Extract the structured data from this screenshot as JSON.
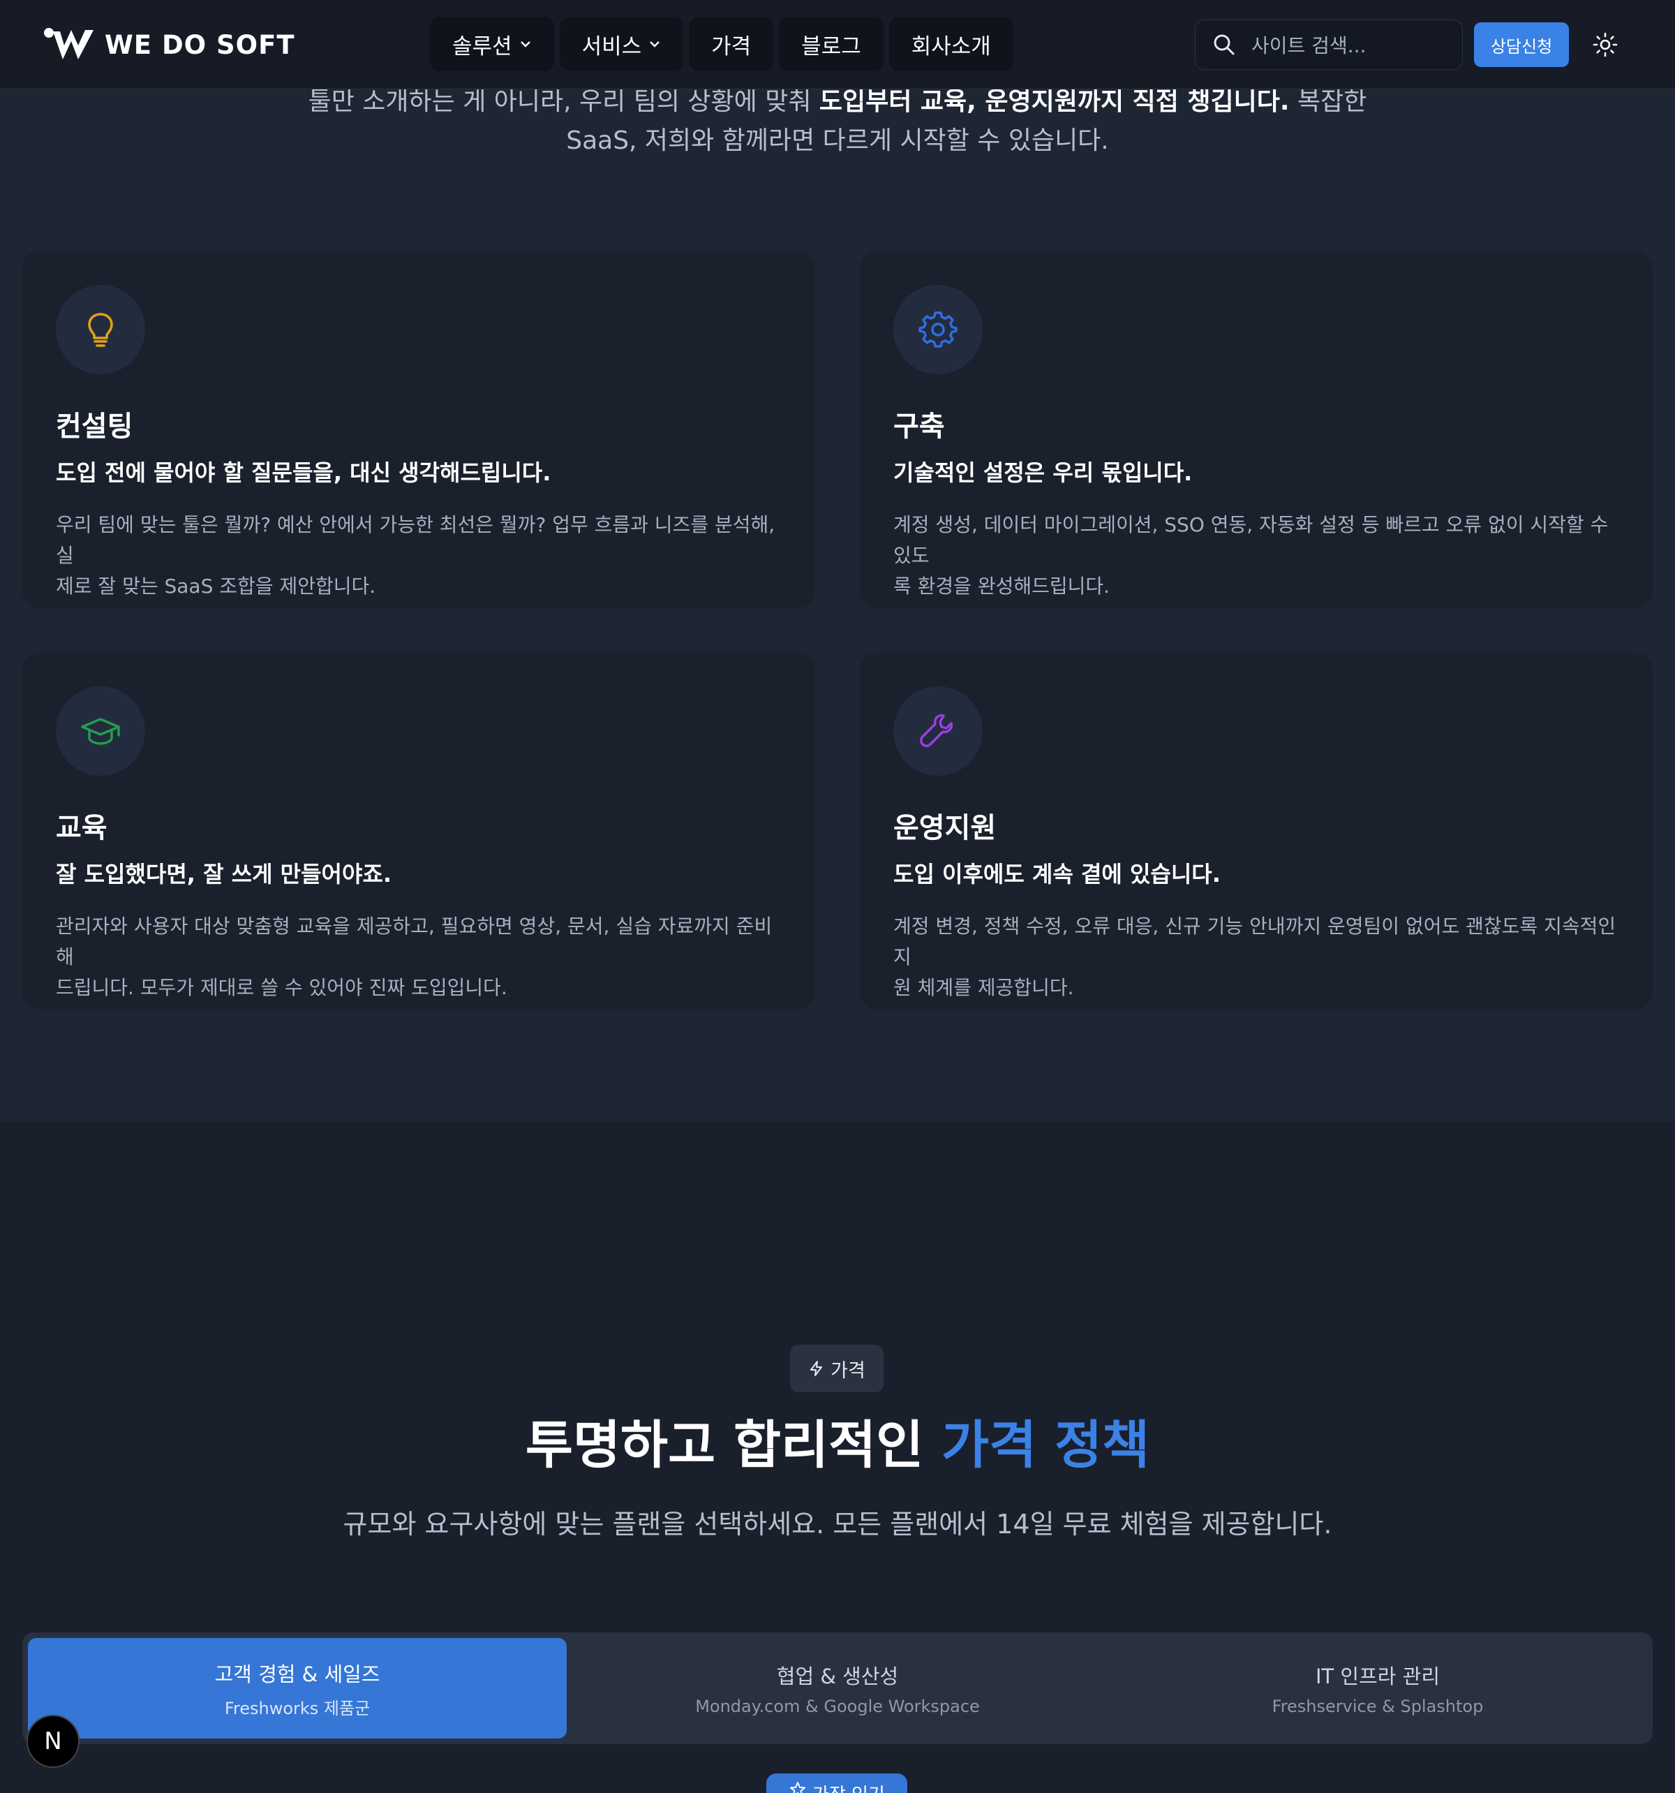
{
  "header": {
    "brand": "WE DO SOFT",
    "nav": [
      {
        "label": "솔루션",
        "has_dropdown": true
      },
      {
        "label": "서비스",
        "has_dropdown": true
      },
      {
        "label": "가격",
        "has_dropdown": false
      },
      {
        "label": "블로그",
        "has_dropdown": false
      },
      {
        "label": "회사소개",
        "has_dropdown": false
      }
    ],
    "search_placeholder": "사이트 검색...",
    "cta_label": "상담신청"
  },
  "intro": {
    "line1_pre": "툴만 소개하는 게 아니라, 우리 팀의 상황에 맞춰 ",
    "line1_bold": "도입부터 교육, 운영지원까지 직접 챙깁니다.",
    "line1_post": " 복잡한",
    "line2": "SaaS, 저희와 함께라면 다르게 시작할 수 있습니다."
  },
  "services": [
    {
      "icon": "lightbulb-icon",
      "icon_color": "#e0a21a",
      "title": "컨설팅",
      "subtitle": "도입 전에 물어야 할 질문들을, 대신 생각해드립니다.",
      "desc_line1": "우리 팀에 맞는 툴은 뭘까? 예산 안에서 가능한 최선은 뭘까? 업무 흐름과 니즈를 분석해, 실",
      "desc_line2": "제로 잘 맞는 SaaS 조합을 제안합니다."
    },
    {
      "icon": "gear-icon",
      "icon_color": "#2f6fe0",
      "title": "구축",
      "subtitle": "기술적인 설정은 우리 몫입니다.",
      "desc_line1": "계정 생성, 데이터 마이그레이션, SSO 연동, 자동화 설정 등 빠르고 오류 없이 시작할 수 있도",
      "desc_line2": "록 환경을 완성해드립니다."
    },
    {
      "icon": "graduation-cap-icon",
      "icon_color": "#22a04b",
      "title": "교육",
      "subtitle": "잘 도입했다면, 잘 쓰게 만들어야죠.",
      "desc_line1": "관리자와 사용자 대상 맞춤형 교육을 제공하고, 필요하면 영상, 문서, 실습 자료까지 준비해",
      "desc_line2": "드립니다. 모두가 제대로 쓸 수 있어야 진짜 도입입니다."
    },
    {
      "icon": "wrench-icon",
      "icon_color": "#9b3fe0",
      "title": "운영지원",
      "subtitle": "도입 이후에도 계속 곁에 있습니다.",
      "desc_line1": "계정 변경, 정책 수정, 오류 대응, 신규 기능 안내까지 운영팀이 없어도 괜찮도록 지속적인 지",
      "desc_line2": "원 체계를 제공합니다."
    }
  ],
  "pricing": {
    "badge": "가격",
    "title_plain": "투명하고 합리적인 ",
    "title_accent": "가격 정책",
    "subtitle": "규모와 요구사항에 맞는 플랜을 선택하세요. 모든 플랜에서 14일 무료 체험을 제공합니다.",
    "tabs": [
      {
        "label": "고객 경험 & 세일즈",
        "sub": "Freshworks 제품군",
        "active": true
      },
      {
        "label": "협업 & 생산성",
        "sub": "Monday.com & Google Workspace",
        "active": false
      },
      {
        "label": "IT 인프라 관리",
        "sub": "Freshservice & Splashtop",
        "active": false
      }
    ],
    "popular_label": "가장 인기"
  },
  "floating_badge": "N",
  "colors": {
    "accent": "#3b82e6",
    "bg": "#1e2533",
    "card": "#1a202c"
  }
}
